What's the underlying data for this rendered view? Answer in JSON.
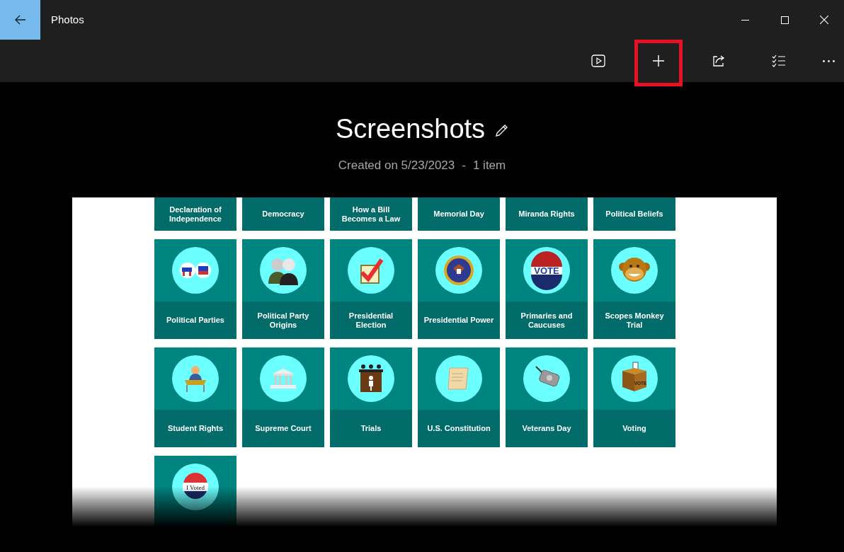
{
  "window": {
    "title": "Photos"
  },
  "toolbar": {
    "buttons": [
      {
        "kind": "slideshow",
        "highlighted": false
      },
      {
        "kind": "add",
        "highlighted": true
      },
      {
        "kind": "share",
        "highlighted": false
      },
      {
        "kind": "select",
        "highlighted": false
      },
      {
        "kind": "more",
        "highlighted": false
      }
    ]
  },
  "album": {
    "title": "Screenshots",
    "created": "Created on 5/23/2023",
    "separator": "-",
    "count": "1 item"
  },
  "screenshot": {
    "rows": [
      [
        {
          "kind": "text",
          "label": "Declaration of Independence"
        },
        {
          "kind": "text",
          "label": "Democracy"
        },
        {
          "kind": "text",
          "label": "How a Bill Becomes a Law"
        },
        {
          "kind": "text",
          "label": "Memorial Day"
        },
        {
          "kind": "text",
          "label": "Miranda Rights"
        },
        {
          "kind": "text",
          "label": "Political Beliefs"
        }
      ],
      [
        {
          "kind": "parties",
          "label": "Political Parties"
        },
        {
          "kind": "founders",
          "label": "Political Party Origins"
        },
        {
          "kind": "check",
          "label": "Presidential Election"
        },
        {
          "kind": "seal",
          "label": "Presidential Power"
        },
        {
          "kind": "vote_pin",
          "label": "Primaries and Caucuses",
          "badge_text": "VOTE"
        },
        {
          "kind": "monkey",
          "label": "Scopes Monkey Trial"
        }
      ],
      [
        {
          "kind": "student",
          "label": "Student Rights"
        },
        {
          "kind": "court",
          "label": "Supreme Court"
        },
        {
          "kind": "trial",
          "label": "Trials"
        },
        {
          "kind": "scroll",
          "label": "U.S. Constitution"
        },
        {
          "kind": "dogtag",
          "label": "Veterans Day"
        },
        {
          "kind": "ballot_box",
          "label": "Voting",
          "badge_text": "VOTE"
        }
      ],
      [
        {
          "kind": "sticker",
          "badge_text": "I Voted"
        }
      ]
    ]
  }
}
